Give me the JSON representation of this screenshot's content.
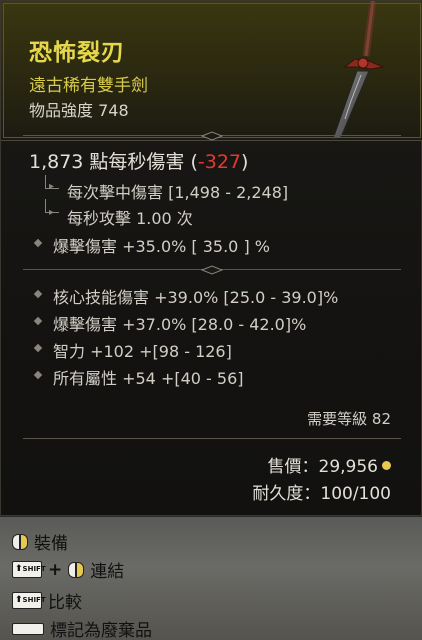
{
  "item": {
    "name": "恐怖裂刃",
    "type": "遠古稀有雙手劍",
    "power": "物品強度 748"
  },
  "dps": {
    "value": "1,873 點每秒傷害 (",
    "delta": "-327",
    "close": ")"
  },
  "base_stats": [
    "每次擊中傷害 [1,498 - 2,248]",
    "每秒攻擊 1.00 次"
  ],
  "implicit": "爆擊傷害 +35.0% [ 35.0 ] %",
  "affixes": [
    "核心技能傷害 +39.0% [25.0 - 39.0]%",
    "爆擊傷害 +37.0% [28.0 - 42.0]%",
    "智力 +102 +[98 - 126]",
    "所有屬性 +54 +[40 - 56]"
  ],
  "required_level": "需要等級 82",
  "sell_price": "售價：29,956",
  "durability": "耐久度：100/100",
  "controls": {
    "equip": "裝備",
    "link": "連結",
    "compare": "比較",
    "mark_junk": "標記為廢棄品",
    "shift_key": "SHIFT",
    "plus": "+"
  },
  "colors": {
    "item_name": "#e6d84a",
    "dps_delta": "#e23b2e",
    "gold_coin": "#e8c850"
  },
  "icons": [
    "sword-icon",
    "diamond-bullet-icon",
    "shift-key-icon",
    "mouse-icon",
    "space-key-icon",
    "gold-coin-icon"
  ]
}
